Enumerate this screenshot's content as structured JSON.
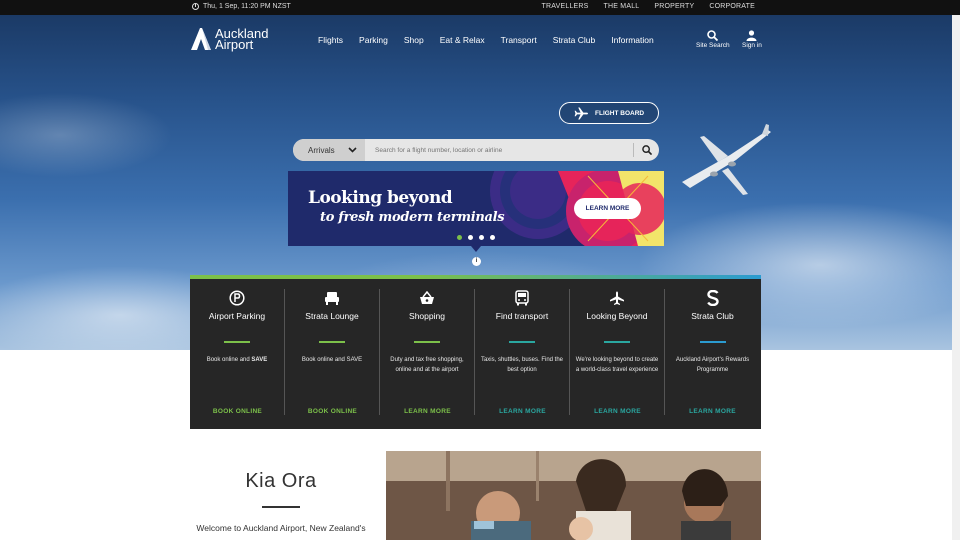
{
  "topbar": {
    "datetime": "Thu, 1 Sep, 11:20 PM NZST",
    "links": [
      "TRAVELLERS",
      "THE MALL",
      "PROPERTY",
      "CORPORATE"
    ]
  },
  "brand": {
    "line1": "Auckland",
    "line2": "Airport"
  },
  "nav": [
    "Flights",
    "Parking",
    "Shop",
    "Eat & Relax",
    "Transport",
    "Strata Club",
    "Information"
  ],
  "utility": {
    "search": "Site Search",
    "signin": "Sign in"
  },
  "flight_board": "FLIGHT BOARD",
  "search": {
    "select_value": "Arrivals",
    "placeholder": "Search for a flight number, location or airline"
  },
  "banner": {
    "line1": "Looking beyond",
    "line2": "to fresh modern terminals",
    "cta": "LEARN MORE",
    "slides": 4,
    "active_slide": 1
  },
  "services": [
    {
      "title": "Airport Parking",
      "desc": "Book online and ",
      "desc_bold": "SAVE",
      "cta": "BOOK ONLINE",
      "accent": "#7cc04a",
      "icon": "parking-icon"
    },
    {
      "title": "Strata Lounge",
      "desc": "Book online and SAVE",
      "desc_bold": "",
      "cta": "BOOK ONLINE",
      "accent": "#7cc04a",
      "icon": "lounge-icon"
    },
    {
      "title": "Shopping",
      "desc": "Duty and tax free shopping, online and at the airport",
      "desc_bold": "",
      "cta": "LEARN MORE",
      "accent": "#7cc04a",
      "icon": "shopping-basket-icon"
    },
    {
      "title": "Find transport",
      "desc": "Taxis, shuttles, buses. Find the best option",
      "desc_bold": "",
      "cta": "LEARN MORE",
      "accent": "#2aa7a0",
      "icon": "bus-icon"
    },
    {
      "title": "Looking Beyond",
      "desc": "We're looking beyond to create a world-class travel experience",
      "desc_bold": "",
      "cta": "LEARN MORE",
      "accent": "#2aa7a0",
      "icon": "plane-icon"
    },
    {
      "title": "Strata Club",
      "desc": "Auckland Airport's Rewards Programme",
      "desc_bold": "",
      "cta": "LEARN MORE",
      "accent": "#2b9bd0",
      "icon": "strata-s-icon"
    }
  ],
  "intro": {
    "heading": "Kia Ora",
    "text": "Welcome to Auckland Airport, New Zealand's"
  }
}
